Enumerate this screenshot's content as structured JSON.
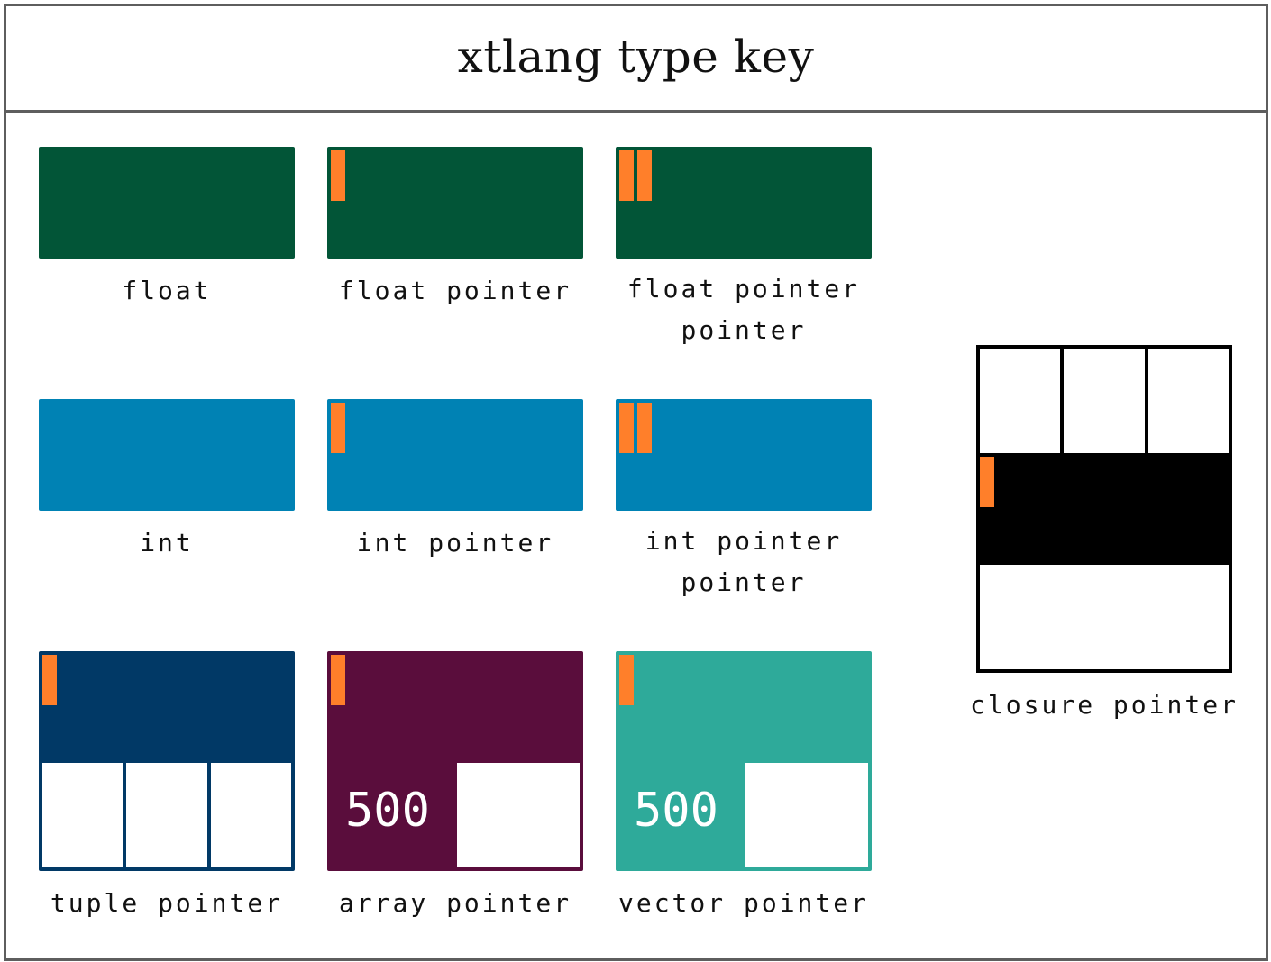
{
  "title": "xtlang type key",
  "colors": {
    "frame": "#5e5e5e",
    "float": "#025537",
    "int": "#0082b4",
    "tuple": "#013966",
    "array": "#5a0d3c",
    "vector": "#2eaa9a",
    "closure": "#000000",
    "pointer_marker": "#ff7f2a"
  },
  "types": {
    "float": {
      "label": "float",
      "pointer_depth": 0
    },
    "float_ptr": {
      "label": "float pointer",
      "pointer_depth": 1
    },
    "float_ptr_ptr": {
      "label": "float pointer\npointer",
      "label_line1": "float pointer",
      "label_line2": "pointer",
      "pointer_depth": 2
    },
    "int": {
      "label": "int",
      "pointer_depth": 0
    },
    "int_ptr": {
      "label": "int pointer",
      "pointer_depth": 1
    },
    "int_ptr_ptr": {
      "label_line1": "int pointer",
      "label_line2": "pointer",
      "pointer_depth": 2
    },
    "tuple_ptr": {
      "label": "tuple pointer",
      "pointer_depth": 1,
      "element_count": 3
    },
    "array_ptr": {
      "label": "array pointer",
      "pointer_depth": 1,
      "length": "500"
    },
    "vector_ptr": {
      "label": "vector pointer",
      "pointer_depth": 1,
      "length": "500"
    },
    "closure_ptr": {
      "label": "closure pointer",
      "pointer_depth": 1,
      "element_count": 3
    }
  }
}
